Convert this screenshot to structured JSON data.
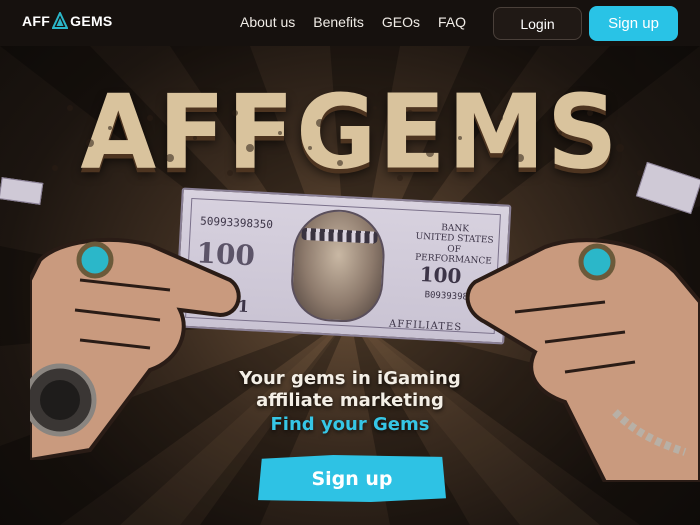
{
  "nav": {
    "logo_left": "AFF",
    "logo_right": "GEMS",
    "links": [
      "About us",
      "Benefits",
      "GEOs",
      "FAQ"
    ],
    "login_label": "Login",
    "signup_label": "Sign up"
  },
  "hero": {
    "title": "AFFGEMS",
    "bill": {
      "serial": "50993398350",
      "serial_short": "B0939398",
      "bank_line1": "BANK",
      "bank_line2": "UNITED STATES",
      "bank_line3": "OF PERFORMANCE",
      "denomination": "100",
      "one": "1",
      "affiliates": "AFFILIATES"
    },
    "tagline_line1": "Your gems in iGaming",
    "tagline_line2": "affiliate marketing",
    "subtitle": "Find your Gems",
    "cta_label": "Sign up"
  },
  "colors": {
    "accent": "#29c3e6",
    "nav_bg": "#16110e",
    "title": "#d9c39d",
    "gem": "#2bb7c9"
  },
  "icons": [
    "gem-icon"
  ]
}
